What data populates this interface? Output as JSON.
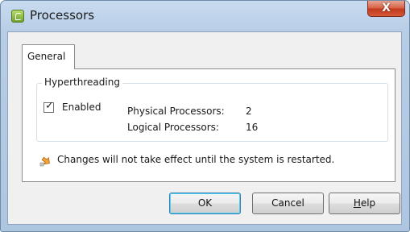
{
  "window": {
    "title": "Processors",
    "close_label": "X"
  },
  "tabs": [
    {
      "label": "General",
      "selected": true
    }
  ],
  "hyperthreading": {
    "group_label": "Hyperthreading",
    "enabled_label": "Enabled",
    "enabled_checked": true,
    "check_glyph": "✓",
    "physical_label": "Physical Processors:",
    "physical_value": "2",
    "logical_label": "Logical Processors:",
    "logical_value": "16"
  },
  "notice": {
    "icon": "warning-arrow-icon",
    "text": "Changes will not take effect until the system is restarted."
  },
  "buttons": {
    "ok": "OK",
    "cancel": "Cancel",
    "help_mnemonic": "H",
    "help_rest": "elp"
  },
  "colors": {
    "title_frame": "#b7cde6",
    "close_button": "#c2391c",
    "notice_icon": "#e08a1e"
  }
}
